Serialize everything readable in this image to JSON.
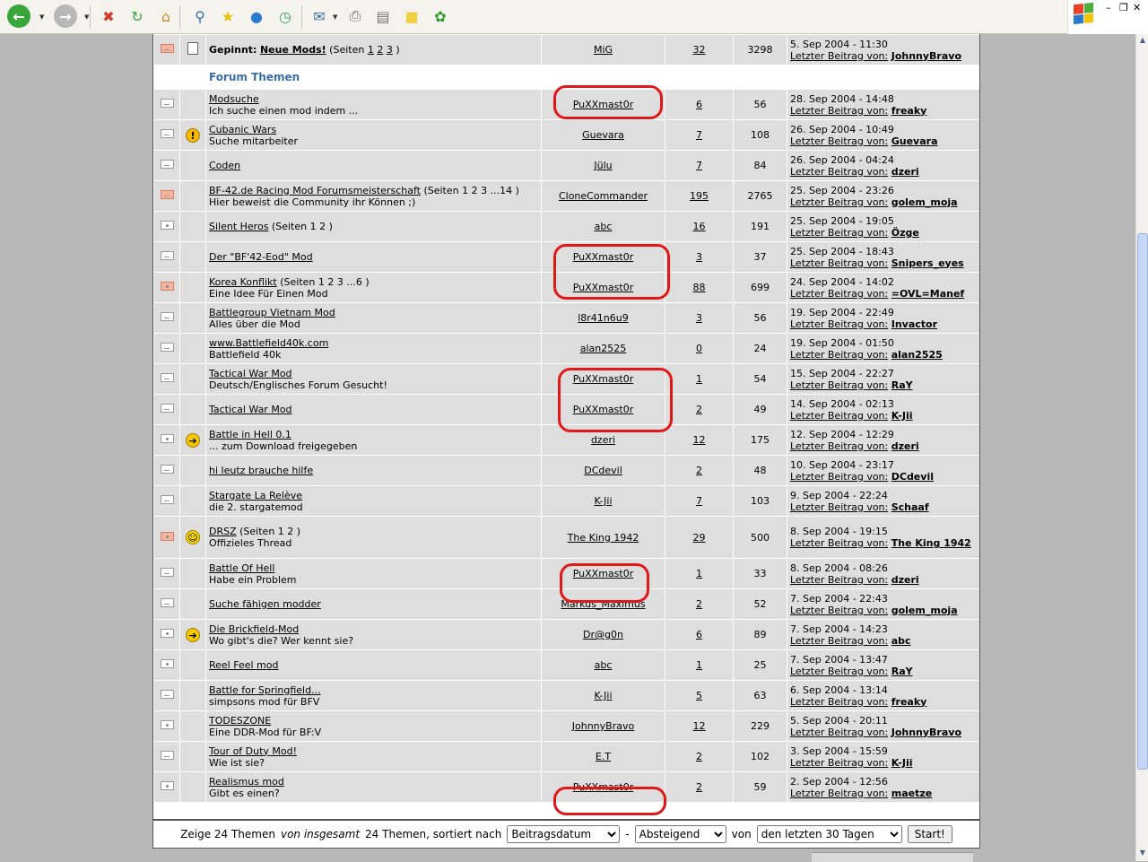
{
  "colors": {
    "page_bg": "#b8b8b8",
    "row_bg": "#dedede",
    "section_text": "#3a6ea5",
    "annotation_red": "#e01818"
  },
  "toolbar": {
    "buttons": [
      {
        "name": "back-button",
        "icon": "back-arrow-icon",
        "glyph": "←",
        "color": "#3aa53a"
      },
      {
        "name": "forward-button",
        "icon": "forward-arrow-icon",
        "glyph": "→",
        "color": "#b8b8b8"
      },
      {
        "name": "stop-button",
        "icon": "stop-icon",
        "glyph": "✖",
        "color": "#d03a2a"
      },
      {
        "name": "refresh-button",
        "icon": "refresh-icon",
        "glyph": "↻",
        "color": "#3aa53a"
      },
      {
        "name": "home-button",
        "icon": "home-icon",
        "glyph": "⌂",
        "color": "#c98a2a"
      },
      {
        "name": "search-button",
        "icon": "magnifier-icon",
        "glyph": "⚲",
        "color": "#3a6ea5"
      },
      {
        "name": "favorites-button",
        "icon": "star-icon",
        "glyph": "★",
        "color": "#e8c000"
      },
      {
        "name": "media-button",
        "icon": "globe-icon",
        "glyph": "●",
        "color": "#2a7ad0"
      },
      {
        "name": "history-button",
        "icon": "history-icon",
        "glyph": "◷",
        "color": "#3a9a5a"
      },
      {
        "name": "mail-button",
        "icon": "mail-icon",
        "glyph": "✉",
        "color": "#3a6ea5"
      },
      {
        "name": "print-button",
        "icon": "printer-icon",
        "glyph": "⎙",
        "color": "#666666"
      },
      {
        "name": "edit-button",
        "icon": "edit-icon",
        "glyph": "▤",
        "color": "#777777"
      },
      {
        "name": "discuss-button",
        "icon": "note-icon",
        "glyph": "■",
        "color": "#f0d040"
      },
      {
        "name": "messenger-button",
        "icon": "icq-flower-icon",
        "glyph": "✿",
        "color": "#2a9a2a"
      }
    ]
  },
  "window": {
    "logo_icon": "windows-flag-icon",
    "minimize": "–",
    "restore": "❐",
    "close": "✕"
  },
  "forum": {
    "pinned": {
      "prefix": "Gepinnt:",
      "title": "Neue Mods!",
      "pages_prefix": " (Seiten ",
      "pages": [
        "1",
        "2",
        "3"
      ],
      "pages_suffix": " )",
      "author": "MiG",
      "replies": "32",
      "views": "3298",
      "last_date": "5. Sep 2004 - 11:30",
      "last_label": "Letzter Beitrag von:",
      "last_user": "JohnnyBravo"
    },
    "section_title": "Forum Themen",
    "last_label": "Letzter Beitrag von:",
    "topics": [
      {
        "title": "Modsuche",
        "desc": "Ich suche einen mod indem ...",
        "author": "PuXXmast0r",
        "replies": "6",
        "views": "56",
        "last_date": "28. Sep 2004 - 14:48",
        "last_user": "freaky",
        "folder": "plain",
        "status": "",
        "tall": false
      },
      {
        "title": "Cubanic Wars",
        "desc": "Suche mitarbeiter",
        "author": "Guevara",
        "replies": "7",
        "views": "108",
        "last_date": "26. Sep 2004 - 10:49",
        "last_user": "Guevara",
        "folder": "plain",
        "status": "warn",
        "tall": false
      },
      {
        "title": "Coden",
        "desc": "",
        "author": "Jülu",
        "replies": "7",
        "views": "84",
        "last_date": "26. Sep 2004 - 04:24",
        "last_user": "dzeri",
        "folder": "plain",
        "status": "",
        "tall": false
      },
      {
        "title": "BF-42.de Racing Mod Forumsmeisterschaft",
        "pages": "(Seiten 1 2 3 ...14 )",
        "desc": "Hier beweist die Community ihr Können ;)",
        "author": "CloneCommander",
        "replies": "195",
        "views": "2765",
        "last_date": "25. Sep 2004 - 23:26",
        "last_user": "golem_moja",
        "folder": "hot",
        "status": "",
        "tall": false
      },
      {
        "title": "Silent Heros",
        "pages": "(Seiten 1 2 )",
        "desc": "",
        "author": "abc",
        "replies": "16",
        "views": "191",
        "last_date": "25. Sep 2004 - 19:05",
        "last_user": "Özge",
        "folder": "dot",
        "status": "",
        "tall": false
      },
      {
        "title": "Der \"BF'42-Eod\" Mod",
        "desc": "",
        "author": "PuXXmast0r",
        "replies": "3",
        "views": "37",
        "last_date": "25. Sep 2004 - 18:43",
        "last_user": "Snipers_eyes",
        "folder": "plain",
        "status": "",
        "tall": false
      },
      {
        "title": "Korea Konflikt",
        "pages": "(Seiten 1 2 3 ...6 )",
        "desc": "Eine Idee Für Einen Mod",
        "author": "PuXXmast0r",
        "replies": "88",
        "views": "699",
        "last_date": "24. Sep 2004 - 14:02",
        "last_user": "=OVL=Manef",
        "folder": "hotdot",
        "status": "",
        "tall": false
      },
      {
        "title": "Battlegroup Vietnam Mod",
        "desc": "Alles über die Mod",
        "author": "l8r41n6u9",
        "replies": "3",
        "views": "56",
        "last_date": "19. Sep 2004 - 22:49",
        "last_user": "Invactor",
        "folder": "plain",
        "status": "",
        "tall": false
      },
      {
        "title": "www.Battlefield40k.com",
        "desc": "Battlefield 40k",
        "author": "alan2525",
        "replies": "0",
        "views": "24",
        "last_date": "19. Sep 2004 - 01:50",
        "last_user": "alan2525",
        "folder": "plain",
        "status": "",
        "tall": false
      },
      {
        "title": "Tactical War Mod",
        "desc": "Deutsch/Englisches Forum Gesucht!",
        "author": "PuXXmast0r",
        "replies": "1",
        "views": "54",
        "last_date": "15. Sep 2004 - 22:27",
        "last_user": "RaY",
        "folder": "plain",
        "status": "",
        "tall": false
      },
      {
        "title": "Tactical War Mod",
        "desc": "",
        "author": "PuXXmast0r",
        "replies": "2",
        "views": "49",
        "last_date": "14. Sep 2004 - 02:13",
        "last_user": "K-Jii",
        "folder": "plain",
        "status": "",
        "tall": false
      },
      {
        "title": "Battle in Hell 0.1",
        "desc": "... zum Download freigegeben",
        "author": "dzeri",
        "replies": "12",
        "views": "175",
        "last_date": "12. Sep 2004 - 12:29",
        "last_user": "dzeri",
        "folder": "dot",
        "status": "arrow",
        "tall": false
      },
      {
        "title": "hi leutz brauche hilfe",
        "desc": "",
        "author": "DCdevil",
        "replies": "2",
        "views": "48",
        "last_date": "10. Sep 2004 - 23:17",
        "last_user": "DCdevil",
        "folder": "plain",
        "status": "",
        "tall": false
      },
      {
        "title": "Stargate La Relève",
        "desc": "die 2. stargatemod",
        "author": "K-Jii",
        "replies": "7",
        "views": "103",
        "last_date": "9. Sep 2004 - 22:24",
        "last_user": "Schaaf",
        "folder": "plain",
        "status": "",
        "tall": false
      },
      {
        "title": "DRSZ",
        "pages": "(Seiten 1 2 )",
        "desc": "Offizieles Thread",
        "author": "The King 1942",
        "replies": "29",
        "views": "500",
        "last_date": "8. Sep 2004 - 19:15",
        "last_user": "The King 1942",
        "folder": "hotdot",
        "status": "smile",
        "tall": true
      },
      {
        "title": "Battle Of Hell",
        "desc": "Habe ein Problem",
        "author": "PuXXmast0r",
        "replies": "1",
        "views": "33",
        "last_date": "8. Sep 2004 - 08:26",
        "last_user": "dzeri",
        "folder": "plain",
        "status": "",
        "tall": false
      },
      {
        "title": "Suche fähigen modder",
        "desc": "",
        "author": "Markus_Maximus",
        "replies": "2",
        "views": "52",
        "last_date": "7. Sep 2004 - 22:43",
        "last_user": "golem_moja",
        "folder": "plain",
        "status": "",
        "tall": false
      },
      {
        "title": "Die Brickfield-Mod",
        "desc": "Wo gibt's die? Wer kennt sie?",
        "author": "Dr@g0n",
        "replies": "6",
        "views": "89",
        "last_date": "7. Sep 2004 - 14:23",
        "last_user": "abc",
        "folder": "dot",
        "status": "arrow",
        "tall": false
      },
      {
        "title": "Reel Feel mod",
        "desc": "",
        "author": "abc",
        "replies": "1",
        "views": "25",
        "last_date": "7. Sep 2004 - 13:47",
        "last_user": "RaY",
        "folder": "dot",
        "status": "",
        "tall": false
      },
      {
        "title": "Battle for Springfield...",
        "desc": "simpsons mod für BFV",
        "author": "K-Jii",
        "replies": "5",
        "views": "63",
        "last_date": "6. Sep 2004 - 13:14",
        "last_user": "freaky",
        "folder": "plain",
        "status": "",
        "tall": false
      },
      {
        "title": "TODESZONE",
        "desc": "Eine DDR-Mod für BF:V",
        "author": "JohnnyBravo",
        "replies": "12",
        "views": "229",
        "last_date": "5. Sep 2004 - 20:11",
        "last_user": "JohnnyBravo",
        "folder": "dot",
        "status": "",
        "tall": false
      },
      {
        "title": "Tour of Duty Mod!",
        "desc": "Wie ist sie?",
        "author": "E.T",
        "replies": "2",
        "views": "102",
        "last_date": "3. Sep 2004 - 15:59",
        "last_user": "K-Jii",
        "folder": "plain",
        "status": "",
        "tall": false
      },
      {
        "title": "Realismus mod",
        "desc": "Gibt es einen?",
        "author": "PuXXmast0r",
        "replies": "2",
        "views": "59",
        "last_date": "2. Sep 2004 - 12:56",
        "last_user": "maetze",
        "folder": "dot",
        "status": "",
        "tall": false
      }
    ]
  },
  "footer": {
    "text1": "Zeige 24 Themen",
    "text2": "von insgesamt",
    "text3": "24 Themen, sortiert nach",
    "sort_by": "Beitragsdatum",
    "dash": "-",
    "order": "Absteigend",
    "text4": "von",
    "range": "den letzten 30 Tagen",
    "submit": "Start!"
  }
}
